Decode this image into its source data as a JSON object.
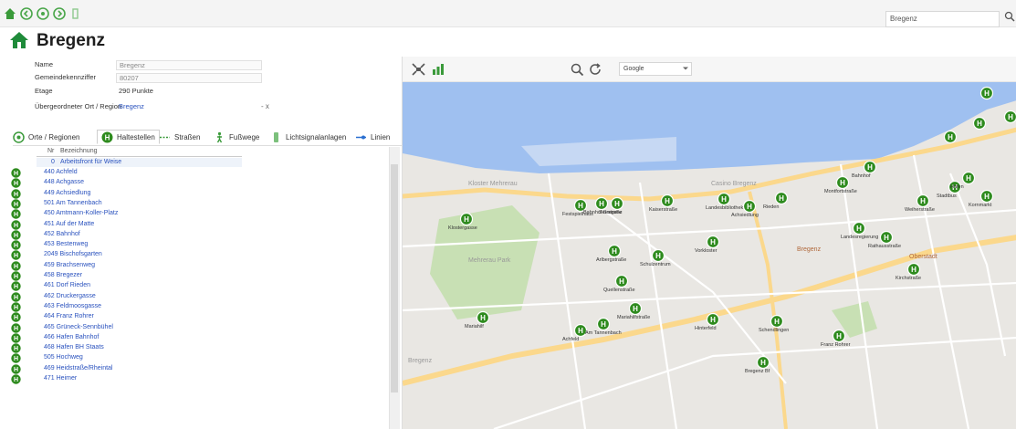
{
  "toolbar": {
    "search_value": "Bregenz",
    "icons": [
      "home-icon",
      "back-icon",
      "history-icon",
      "forward-icon",
      "bookmark-icon"
    ]
  },
  "header": {
    "title": "Bregenz"
  },
  "form": {
    "fields": [
      {
        "label": "Name",
        "value": "Bregenz",
        "style": "input"
      },
      {
        "label": "Gemeindekennziffer",
        "value": "80207",
        "style": "input"
      },
      {
        "label": "Etage",
        "value": "290 Punkte",
        "style": "plain"
      },
      {
        "label": "Übergeordneter Ort / Region",
        "value": "Bregenz",
        "style": "link",
        "note": "- x"
      }
    ]
  },
  "tabs": [
    {
      "label": "Orte / Regionen",
      "icon": "region-icon",
      "active": false
    },
    {
      "label": "Haltestellen",
      "icon": "bus-stop-icon",
      "active": true
    },
    {
      "label": "Straßen",
      "icon": "street-icon",
      "active": false
    },
    {
      "label": "Fußwege",
      "icon": "pedestrian-icon",
      "active": false
    },
    {
      "label": "Lichtsignalanlagen",
      "icon": "traffic-light-icon",
      "active": false
    },
    {
      "label": "Linien",
      "icon": "line-icon",
      "active": false
    }
  ],
  "list": {
    "columns": [
      "Nr",
      "Bezeichnung"
    ],
    "subheader": {
      "nr": "0",
      "name": "Arbeitsfront für Weise"
    },
    "rows": [
      "440 Achfeld",
      "448 Achgasse",
      "449 Achsiedlung",
      "501 Am Tannenbach",
      "450 Amtmann-Koller-Platz",
      "451 Auf der Matte",
      "452 Bahnhof",
      "453 Bestenweg",
      "2049 Bischofsgarten",
      "459 Brachsenweg",
      "458 Bregezer",
      "461 Dorf Rieden",
      "462 Druckergasse",
      "463 Feldmoosgasse",
      "464 Franz Rohrer",
      "465 Grüneck-Sennbühel",
      "466 Hafen Bahnhof",
      "468 Hafen BH Staats",
      "505 Hochweg",
      "469 Heidstraße/Rheintal",
      "471 Heimer"
    ]
  },
  "map_toolbar": {
    "map_type": "Google",
    "icons": [
      "fit-extent-icon",
      "chart-icon",
      "zoom-icon",
      "refresh-icon"
    ]
  },
  "map": {
    "place_labels": [
      {
        "text": "Kloster Mehrerau",
        "style": "grey"
      },
      {
        "text": "Casino Bregenz",
        "style": "grey"
      },
      {
        "text": "Bregenz",
        "style": "orange"
      },
      {
        "text": "Mehrerau Park",
        "style": "grey"
      },
      {
        "text": "Oberstadt",
        "style": "orange"
      },
      {
        "text": "Bregenz",
        "style": "grey"
      }
    ],
    "stops": [
      "Klostergasse",
      "Bahnhof Bregenz",
      "Seestraße",
      "Festspielhaus",
      "Kaiserstraße",
      "Landesbibliothek",
      "Achsiedlung",
      "Rieden",
      "Bahnhof",
      "Montfortstraße",
      "Weiherstraße",
      "Kornmarkt",
      "Stadtbus",
      "Hafen",
      "Rathausstraße",
      "Landesregierung",
      "Kirchstraße",
      "Vorkloster",
      "Schulzentrum",
      "Arlbergstraße",
      "Quellenstraße",
      "Mariahilfstraße",
      "Am Tannenbach",
      "Achfeld",
      "Mariahilf",
      "Hinterfeld",
      "Schendlingen",
      "Franz Rohrer",
      "Bregenz Bf"
    ]
  },
  "colors": {
    "accent": "#2a52be",
    "stop_green": "#2e8b1e",
    "water": "#9fc0f0",
    "land": "#e8e6e2",
    "park": "#c8e0b4",
    "road_major": "#fbd88c",
    "road_minor": "#ffffff"
  }
}
